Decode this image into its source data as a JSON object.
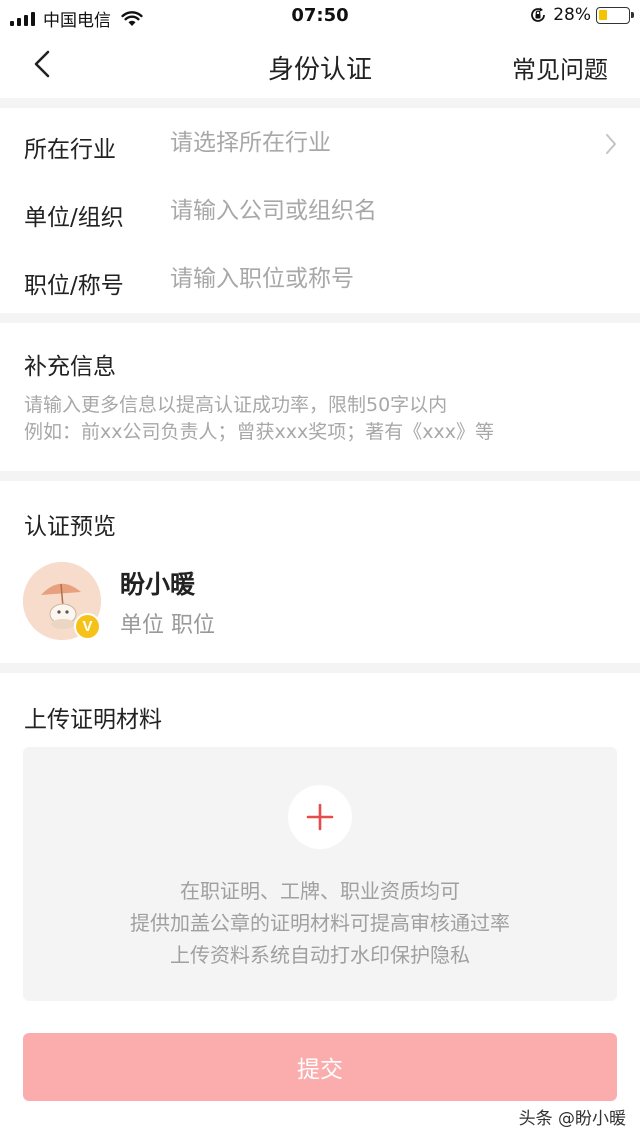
{
  "status_bar": {
    "carrier": "中国电信",
    "time": "07:50",
    "battery": "28%",
    "battery_level": 0.28
  },
  "nav": {
    "title": "身份认证",
    "faq": "常见问题"
  },
  "form": {
    "industry": {
      "label": "所在行业",
      "placeholder": "请选择所在行业"
    },
    "organization": {
      "label": "单位/组织",
      "placeholder": "请输入公司或组织名"
    },
    "position": {
      "label": "职位/称号",
      "placeholder": "请输入职位或称号"
    }
  },
  "supplement": {
    "title": "补充信息",
    "placeholder_line1": "请输入更多信息以提高认证成功率，限制50字以内",
    "placeholder_line2": "例如：前xx公司负责人；曾获xxx奖项；著有《xxx》等"
  },
  "preview": {
    "title": "认证预览",
    "name": "盼小暖",
    "subtitle": "单位 职位",
    "badge": "V"
  },
  "upload": {
    "title": "上传证明材料",
    "tips": [
      "在职证明、工牌、职业资质均可",
      "提供加盖公章的证明材料可提高审核通过率",
      "上传资料系统自动打水印保护隐私"
    ]
  },
  "submit": {
    "label": "提交"
  },
  "watermark": "头条 @盼小暖",
  "colors": {
    "accent": "#e94a4a",
    "submit_disabled": "#fbadad",
    "badge": "#f6c21a"
  }
}
